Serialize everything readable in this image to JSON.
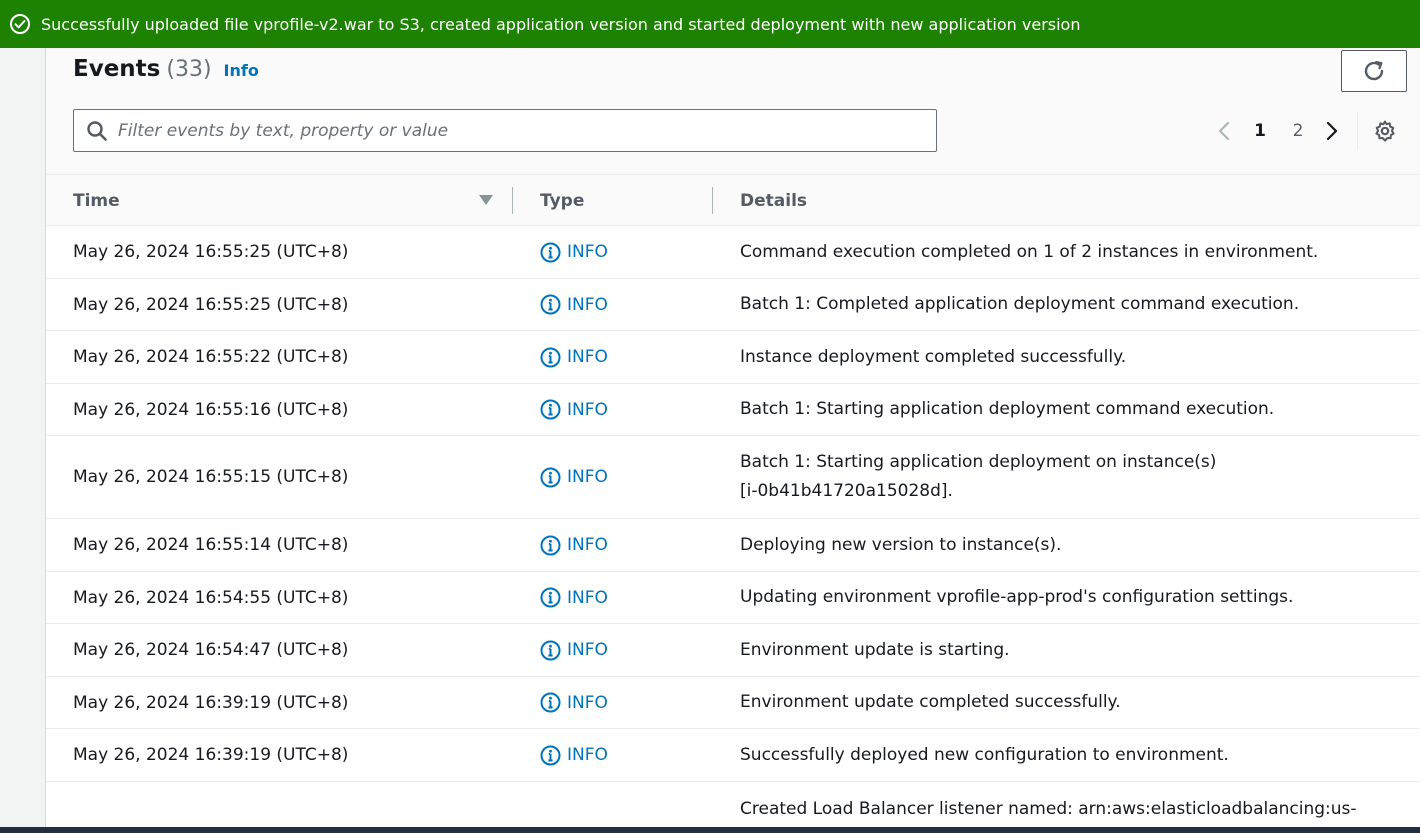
{
  "banner": {
    "message": "Successfully uploaded file vprofile-v2.war to S3, created application version and started deployment with new application version",
    "color": "#1d8102"
  },
  "events": {
    "title": "Events",
    "count": "(33)",
    "info_link": "Info",
    "search_placeholder": "Filter events by text, property or value",
    "pagination": {
      "current": "1",
      "next_page": "2"
    },
    "columns": {
      "time": "Time",
      "type": "Type",
      "details": "Details"
    },
    "rows": [
      {
        "time": "May 26, 2024 16:55:25 (UTC+8)",
        "type": "INFO",
        "details": "Command execution completed on 1 of 2 instances in environment."
      },
      {
        "time": "May 26, 2024 16:55:25 (UTC+8)",
        "type": "INFO",
        "details": "Batch 1: Completed application deployment command execution."
      },
      {
        "time": "May 26, 2024 16:55:22 (UTC+8)",
        "type": "INFO",
        "details": "Instance deployment completed successfully."
      },
      {
        "time": "May 26, 2024 16:55:16 (UTC+8)",
        "type": "INFO",
        "details": "Batch 1: Starting application deployment command execution."
      },
      {
        "time": "May 26, 2024 16:55:15 (UTC+8)",
        "type": "INFO",
        "details": "Batch 1: Starting application deployment on instance(s) [i-0b41b41720a15028d]."
      },
      {
        "time": "May 26, 2024 16:55:14 (UTC+8)",
        "type": "INFO",
        "details": "Deploying new version to instance(s)."
      },
      {
        "time": "May 26, 2024 16:54:55 (UTC+8)",
        "type": "INFO",
        "details": "Updating environment vprofile-app-prod's configuration settings."
      },
      {
        "time": "May 26, 2024 16:54:47 (UTC+8)",
        "type": "INFO",
        "details": "Environment update is starting."
      },
      {
        "time": "May 26, 2024 16:39:19 (UTC+8)",
        "type": "INFO",
        "details": "Environment update completed successfully."
      },
      {
        "time": "May 26, 2024 16:39:19 (UTC+8)",
        "type": "INFO",
        "details": "Successfully deployed new configuration to environment."
      },
      {
        "time": "",
        "type": "",
        "details": "Created Load Balancer listener named: arn:aws:elasticloadbalancing:us-"
      }
    ]
  },
  "icons": {
    "banner": "check-circle-icon",
    "refresh": "refresh-icon",
    "search": "search-icon",
    "prev": "chevron-left-icon",
    "next": "chevron-right-icon",
    "settings": "gear-icon",
    "sort": "caret-down-icon",
    "type": "info-circle-icon"
  },
  "colors": {
    "link": "#0073bb",
    "text": "#16191f",
    "muted": "#687078"
  }
}
